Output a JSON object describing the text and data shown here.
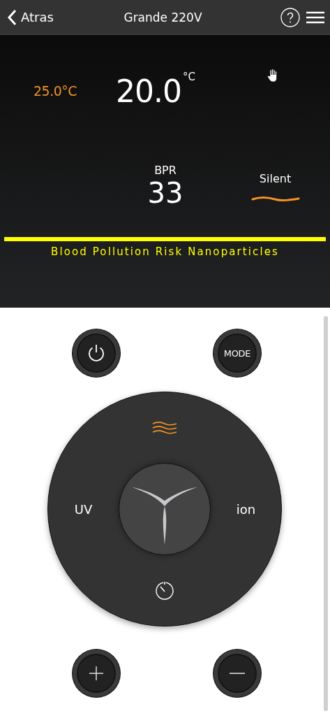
{
  "header": {
    "back_label": "Atras",
    "title": "Grande 220V"
  },
  "display": {
    "set_temperature": "25.0",
    "set_unit": "°C",
    "current_temperature": "20.0",
    "current_unit": "°C",
    "bpr_label": "BPR",
    "bpr_value": "33",
    "fan_mode": "Silent",
    "risk_label": "Blood Pollution Risk Nanoparticles"
  },
  "controls": {
    "mode_label": "MODE",
    "uv_label": "UV",
    "ion_label": "ion"
  }
}
